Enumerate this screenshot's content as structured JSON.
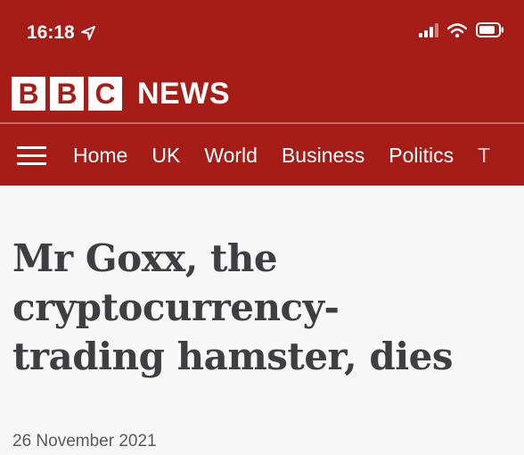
{
  "status_bar": {
    "time": "16:18",
    "icons": [
      "location-arrow-icon",
      "signal-icon",
      "wifi-icon",
      "battery-icon"
    ]
  },
  "header": {
    "logo_letters": [
      "B",
      "B",
      "C"
    ],
    "logo_word": "NEWS",
    "nav_items": [
      "Home",
      "UK",
      "World",
      "Business",
      "Politics",
      "T"
    ]
  },
  "article": {
    "headline_lines": [
      "Mr Goxx, the",
      "cryptocurrency-",
      "trading hamster, dies"
    ],
    "date": "26 November 2021"
  },
  "colors": {
    "brand_red": "#a61d17",
    "headline_text": "#3f3f42",
    "background": "#f7f7f7"
  }
}
